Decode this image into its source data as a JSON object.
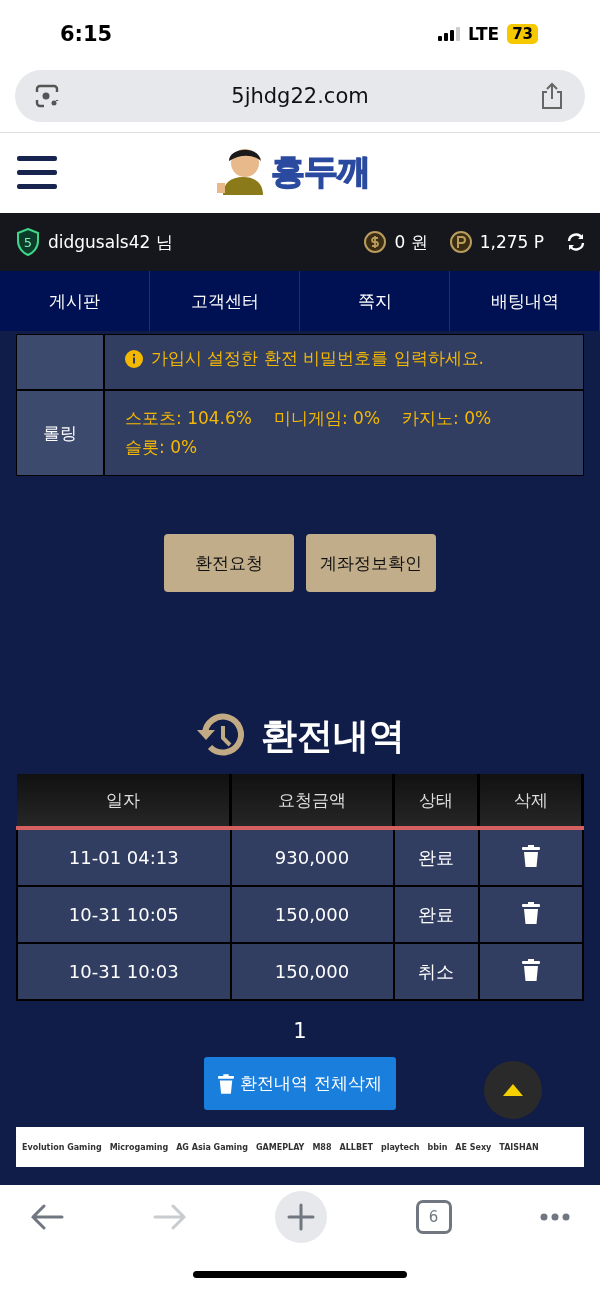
{
  "status_bar": {
    "time": "6:15",
    "network": "LTE",
    "battery": "73"
  },
  "browser": {
    "url": "5jhdg22.com",
    "tab_count": "6"
  },
  "site": {
    "logo_text": "홍두깨"
  },
  "user_bar": {
    "level": "5",
    "username": "didgusals42 님",
    "money": "0 원",
    "points": "1,275 P"
  },
  "nav": [
    {
      "label": "게시판"
    },
    {
      "label": "고객센터"
    },
    {
      "label": "쪽지"
    },
    {
      "label": "배팅내역"
    }
  ],
  "form_rows": [
    {
      "label": "",
      "kind": "notice",
      "lines": [
        "가입시 설정한 환전 비밀번호를 입력하세요."
      ]
    },
    {
      "label": "롤링",
      "kind": "rolling",
      "lines": [
        "스포츠: 104.6%",
        "미니게임: 0%",
        "카지노: 0%",
        "슬롯: 0%"
      ]
    }
  ],
  "buttons": [
    "환전요청",
    "계좌정보확인"
  ],
  "history": {
    "title": "환전내역",
    "columns": [
      "일자",
      "요청금액",
      "상태",
      "삭제"
    ],
    "rows": [
      [
        "11-01 04:13",
        "930,000",
        "완료"
      ],
      [
        "10-31 10:05",
        "150,000",
        "완료"
      ],
      [
        "10-31 10:03",
        "150,000",
        "취소"
      ]
    ],
    "page": "1",
    "delete_all": "환전내역 전체삭제"
  },
  "providers": [
    "Evolution Gaming",
    "Microgaming",
    "AG Asia Gaming",
    "GAMEPLAY",
    "M88",
    "ALLBET",
    "playtech",
    "bbin",
    "AE Sexy",
    "TAISHAN"
  ]
}
